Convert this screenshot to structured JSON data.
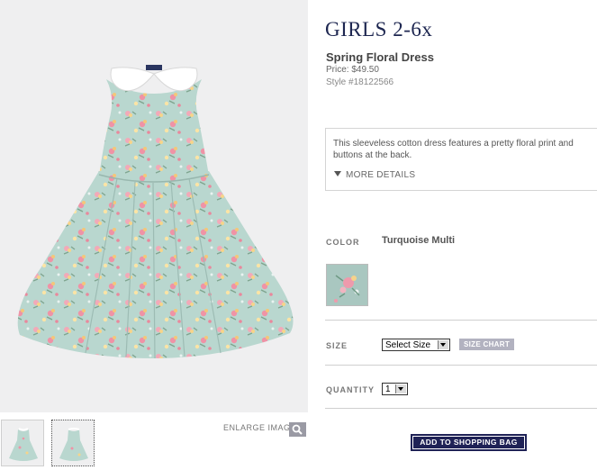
{
  "category_title": "GIRLS 2-6x",
  "product": {
    "name": "Spring Floral Dress",
    "price": "Price: $49.50",
    "style": "Style #18122566",
    "description": "This sleeveless cotton dress features a pretty floral print and buttons at the back.",
    "more_details": "MORE DETAILS"
  },
  "image_area": {
    "enlarge_label": "ENLARGE IMAGE"
  },
  "color": {
    "label": "COLOR",
    "value": "Turquoise Multi",
    "swatch_color": "#a9c7c0"
  },
  "size": {
    "label": "SIZE",
    "selected": "Select Size",
    "size_chart": "SIZE CHART"
  },
  "quantity": {
    "label": "QUANTITY",
    "selected": "1"
  },
  "add_to_bag": "ADD TO SHOPPING BAG",
  "colors": {
    "title_navy": "#1d2650",
    "button_navy": "#1f2256",
    "dress_mint": "#b9d7cf",
    "size_chart_bg": "#b2b2c0"
  }
}
